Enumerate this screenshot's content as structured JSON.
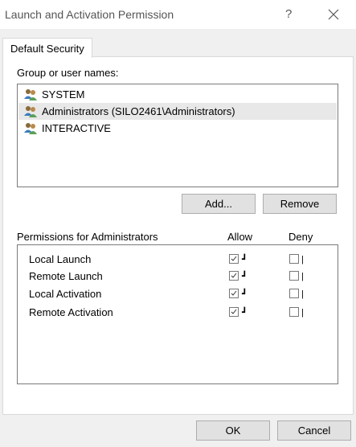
{
  "window": {
    "title": "Launch and Activation Permission",
    "help_glyph": "?",
    "close_glyph": "close"
  },
  "tab": {
    "label": "Default Security"
  },
  "groups": {
    "label": "Group or user names:",
    "items": [
      {
        "name": "SYSTEM",
        "icon": "user-group-icon",
        "selected": false
      },
      {
        "name": "Administrators (SILO2461\\Administrators)",
        "icon": "user-group-icon",
        "selected": true
      },
      {
        "name": "INTERACTIVE",
        "icon": "user-group-icon",
        "selected": false
      }
    ],
    "add_label": "Add...",
    "remove_label": "Remove"
  },
  "permissions": {
    "label": "Permissions for Administrators",
    "allow_header": "Allow",
    "deny_header": "Deny",
    "rows": [
      {
        "name": "Local Launch",
        "allow": true,
        "deny": false
      },
      {
        "name": "Remote Launch",
        "allow": true,
        "deny": false
      },
      {
        "name": "Local Activation",
        "allow": true,
        "deny": false
      },
      {
        "name": "Remote Activation",
        "allow": true,
        "deny": false
      }
    ]
  },
  "footer": {
    "ok_label": "OK",
    "cancel_label": "Cancel"
  },
  "colors": {
    "selection": "#e8e8e8",
    "button": "#e1e1e1",
    "icon_blue": "#3b7bbf",
    "icon_green": "#5aa05a"
  }
}
